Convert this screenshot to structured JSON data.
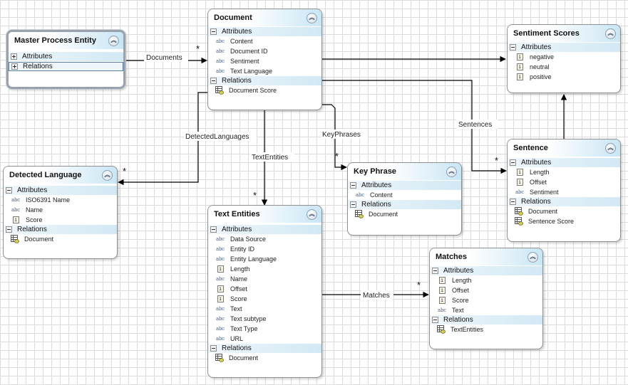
{
  "entities": {
    "master": {
      "title": "Master Process Entity",
      "sections": [
        "Attributes",
        "Relations"
      ]
    },
    "document": {
      "title": "Document",
      "attributes_label": "Attributes",
      "attributes": [
        {
          "icon": "abc",
          "name": "Content"
        },
        {
          "icon": "abc",
          "name": "Document ID"
        },
        {
          "icon": "abc",
          "name": "Sentiment"
        },
        {
          "icon": "abc",
          "name": "Text Language"
        }
      ],
      "relations_label": "Relations",
      "relations": [
        {
          "name": "Document Score"
        }
      ]
    },
    "sentiment": {
      "title": "Sentiment Scores",
      "attributes_label": "Attributes",
      "attributes": [
        {
          "icon": "1",
          "name": "negative"
        },
        {
          "icon": "1",
          "name": "neutral"
        },
        {
          "icon": "1",
          "name": "positive"
        }
      ]
    },
    "detected": {
      "title": "Detected Language",
      "attributes_label": "Attributes",
      "attributes": [
        {
          "icon": "abc",
          "name": "ISO6391 Name"
        },
        {
          "icon": "abc",
          "name": "Name"
        },
        {
          "icon": "1",
          "name": "Score"
        }
      ],
      "relations_label": "Relations",
      "relations": [
        {
          "name": "Document"
        }
      ]
    },
    "keyphrase": {
      "title": "Key Phrase",
      "attributes_label": "Attributes",
      "attributes": [
        {
          "icon": "abc",
          "name": "Content"
        }
      ],
      "relations_label": "Relations",
      "relations": [
        {
          "name": "Document"
        }
      ]
    },
    "sentence": {
      "title": "Sentence",
      "attributes_label": "Attributes",
      "attributes": [
        {
          "icon": "1",
          "name": "Length"
        },
        {
          "icon": "1",
          "name": "Offset"
        },
        {
          "icon": "abc",
          "name": "Sentiment"
        }
      ],
      "relations_label": "Relations",
      "relations": [
        {
          "name": "Document"
        },
        {
          "name": "Sentence Score"
        }
      ]
    },
    "textentities": {
      "title": "Text Entities",
      "attributes_label": "Attributes",
      "attributes": [
        {
          "icon": "abc",
          "name": "Data Source"
        },
        {
          "icon": "abc",
          "name": "Entity ID"
        },
        {
          "icon": "abc",
          "name": "Entity Language"
        },
        {
          "icon": "1",
          "name": "Length"
        },
        {
          "icon": "abc",
          "name": "Name"
        },
        {
          "icon": "1",
          "name": "Offset"
        },
        {
          "icon": "1",
          "name": "Score"
        },
        {
          "icon": "abc",
          "name": "Text"
        },
        {
          "icon": "abc",
          "name": "Text subtype"
        },
        {
          "icon": "abc",
          "name": "Text Type"
        },
        {
          "icon": "abc",
          "name": "URL"
        }
      ],
      "relations_label": "Relations",
      "relations": [
        {
          "name": "Document"
        }
      ]
    },
    "matches": {
      "title": "Matches",
      "attributes_label": "Attributes",
      "attributes": [
        {
          "icon": "1",
          "name": "Length"
        },
        {
          "icon": "1",
          "name": "Offset"
        },
        {
          "icon": "1",
          "name": "Score"
        },
        {
          "icon": "abc",
          "name": "Text"
        }
      ],
      "relations_label": "Relations",
      "relations": [
        {
          "name": "TextEntities"
        }
      ]
    }
  },
  "connectors": {
    "documents": {
      "label": "Documents",
      "multiplicity": "*"
    },
    "detected_languages": {
      "label": "DetectedLanguages",
      "multiplicity": "*"
    },
    "text_entities": {
      "label": "TextEntities",
      "multiplicity": "*"
    },
    "key_phrases": {
      "label": "KeyPhrases",
      "multiplicity": "*"
    },
    "sentences": {
      "label": "Sentences",
      "multiplicity": "*"
    },
    "matches": {
      "label": "Matches",
      "multiplicity": "*"
    }
  },
  "icons": {
    "collapse": "double-chevron-up-icon",
    "string_attribute": "abc-icon",
    "numeric_attribute": "number-one-icon",
    "relation": "table-relation-icon"
  },
  "colors": {
    "title_gradient_end": "#c9e6f5",
    "section_header": "#d2e9f4",
    "connector": "#000000",
    "border": "#8f8f8f"
  }
}
